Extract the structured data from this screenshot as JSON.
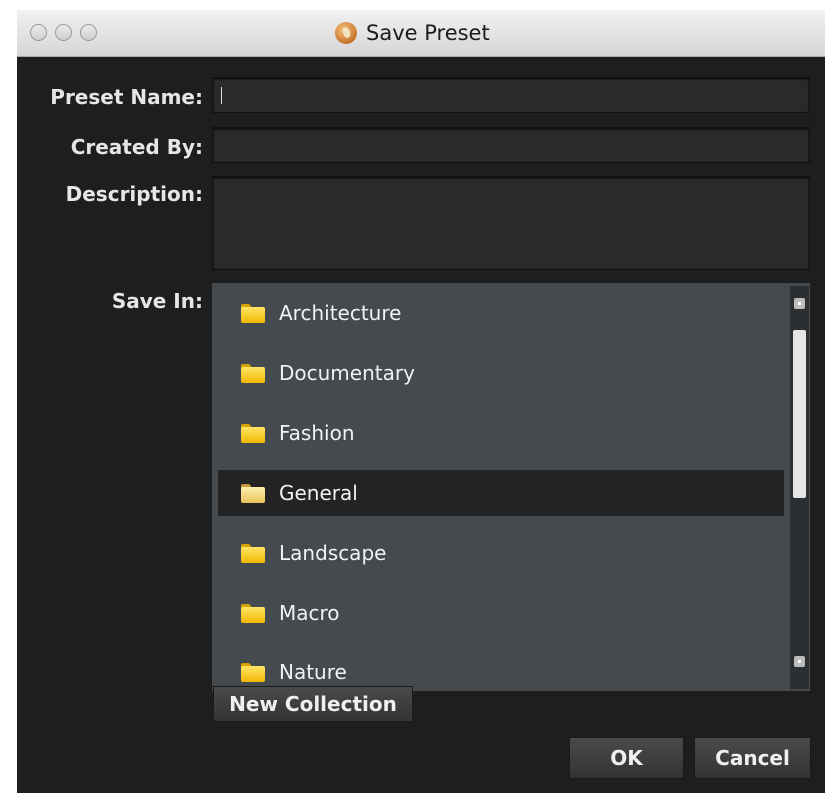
{
  "window": {
    "title": "Save Preset",
    "close_label": "",
    "minimize_label": "",
    "zoom_label": ""
  },
  "form": {
    "preset_name_label": "Preset Name:",
    "preset_name_value": "",
    "created_by_label": "Created By:",
    "created_by_value": "",
    "description_label": "Description:",
    "description_value": "",
    "save_in_label": "Save In:"
  },
  "collections": {
    "items": [
      {
        "label": "Architecture",
        "selected": false
      },
      {
        "label": "Documentary",
        "selected": false
      },
      {
        "label": "Fashion",
        "selected": false
      },
      {
        "label": "General",
        "selected": true
      },
      {
        "label": "Landscape",
        "selected": false
      },
      {
        "label": "Macro",
        "selected": false
      },
      {
        "label": "Nature",
        "selected": false
      }
    ]
  },
  "buttons": {
    "new_collection": "New Collection",
    "ok": "OK",
    "cancel": "Cancel"
  },
  "colors": {
    "window_bg": "#1e1e1e",
    "list_bg": "#454a4f",
    "selected_row": "#232323",
    "folder_yellow": "#f2b805"
  }
}
